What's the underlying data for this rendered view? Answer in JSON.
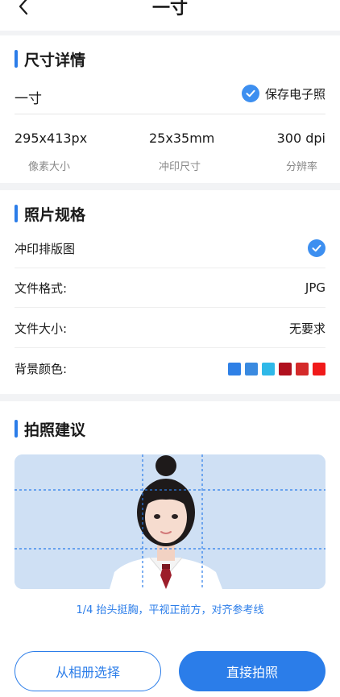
{
  "header": {
    "title": "一寸"
  },
  "size_details": {
    "section_title": "尺寸详情",
    "size_name": "一寸",
    "save_label": "保存电子照",
    "stats": [
      {
        "value": "295x413px",
        "label": "像素大小"
      },
      {
        "value": "25x35mm",
        "label": "冲印尺寸"
      },
      {
        "value": "300 dpi",
        "label": "分辨率"
      }
    ]
  },
  "photo_spec": {
    "section_title": "照片规格",
    "print_layout_label": "冲印排版图",
    "format_label": "文件格式:",
    "format_value": "JPG",
    "filesize_label": "文件大小:",
    "filesize_value": "无要求",
    "bg_label": "背景颜色:",
    "bg_colors": [
      "#2f80e6",
      "#3a8ae0",
      "#2fb8e8",
      "#b0101e",
      "#d42a2a",
      "#f01a1a"
    ]
  },
  "advice": {
    "section_title": "拍照建议",
    "tip": "1/4  抬头挺胸，平视正前方，对齐参考线"
  },
  "actions": {
    "album_label": "从相册选择",
    "shoot_label": "直接拍照"
  },
  "colors": {
    "accent": "#2b7de9",
    "photo_bg": "#cfe0f4"
  }
}
